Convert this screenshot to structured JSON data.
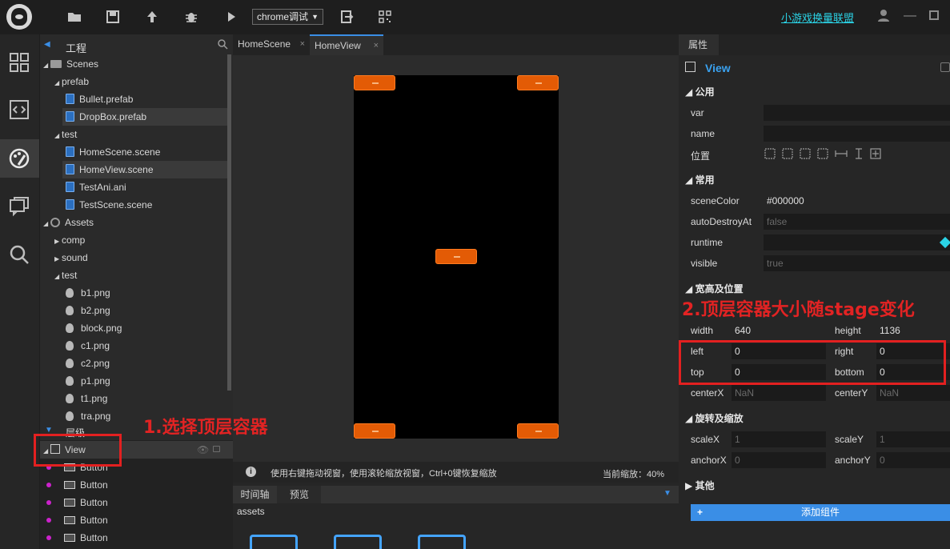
{
  "toolbar": {
    "run_target": "chrome调试",
    "alliance_link": "小游戏换量联盟",
    "icons": [
      "folder-icon",
      "save-icon",
      "publish-icon",
      "debug-icon",
      "play-icon",
      "export-icon",
      "qrcode-icon"
    ]
  },
  "project_panel": {
    "title": "工程",
    "tree": [
      {
        "label": "Scenes",
        "icon": "folder-icon",
        "expanded": true
      },
      {
        "label": "prefab",
        "expanded": true
      },
      {
        "label": "Bullet.prefab",
        "icon": "prefab-file-icon"
      },
      {
        "label": "DropBox.prefab",
        "icon": "prefab-file-icon",
        "selected": true
      },
      {
        "label": "test",
        "expanded": true
      },
      {
        "label": "HomeScene.scene",
        "icon": "scene-file-icon"
      },
      {
        "label": "HomeView.scene",
        "icon": "scene-file-icon",
        "selected": true
      },
      {
        "label": "TestAni.ani",
        "icon": "ani-file-icon"
      },
      {
        "label": "TestScene.scene",
        "icon": "scene-file-icon"
      },
      {
        "label": "Assets",
        "icon": "globe-icon",
        "expanded": true
      },
      {
        "label": "comp",
        "expanded": false
      },
      {
        "label": "sound",
        "expanded": false
      },
      {
        "label": "test",
        "expanded": true
      },
      {
        "label": "b1.png"
      },
      {
        "label": "b2.png"
      },
      {
        "label": "block.png"
      },
      {
        "label": "c1.png"
      },
      {
        "label": "c2.png"
      },
      {
        "label": "p1.png"
      },
      {
        "label": "t1.png"
      },
      {
        "label": "tra.png"
      }
    ]
  },
  "layer_panel": {
    "title": "层级",
    "root": "View",
    "children": [
      "Button",
      "Button",
      "Button",
      "Button",
      "Button"
    ]
  },
  "editor": {
    "tabs": [
      "HomeScene",
      "HomeView"
    ],
    "active_tab": "HomeView",
    "hint": "使用右键拖动视窗，使用滚轮缩放视窗，Ctrl+0键恢复缩放",
    "zoom_label": "当前缩放：40%",
    "bottom_tabs": [
      "时间轴",
      "预览"
    ],
    "assets_label": "assets"
  },
  "properties": {
    "tab": "属性",
    "node": "View",
    "sections": {
      "common": "公用",
      "normal": "常用",
      "size_pos": "宽高及位置",
      "rotate_scale": "旋转及缩放",
      "other": "其他"
    },
    "var_label": "var",
    "name_label": "name",
    "position_label": "位置",
    "sceneColor_label": "sceneColor",
    "sceneColor": "#000000",
    "autoDestroyAt_label": "autoDestroyAt",
    "autoDestroyAt": "false",
    "runtime_label": "runtime",
    "visible_label": "visible",
    "visible": "true",
    "width_label": "width",
    "width": "640",
    "height_label": "height",
    "height": "1136",
    "left_label": "left",
    "left": "0",
    "right_label": "right",
    "right": "0",
    "top_label": "top",
    "top": "0",
    "bottom_label": "bottom",
    "bottom": "0",
    "centerX_label": "centerX",
    "centerX": "NaN",
    "centerY_label": "centerY",
    "centerY": "NaN",
    "scaleX_label": "scaleX",
    "scaleX": "1",
    "scaleY_label": "scaleY",
    "scaleY": "1",
    "anchorX_label": "anchorX",
    "anchorX": "0",
    "anchorY_label": "anchorY",
    "anchorY": "0",
    "add_component": "添加组件"
  },
  "annotations": {
    "step1": "1.选择顶层容器",
    "step2": "2.顶层容器大小随stage变化",
    "color": "#e32020"
  },
  "colors": {
    "accent": "#3a8ee6",
    "button": "#e35b05",
    "link": "#2bd3e6"
  }
}
